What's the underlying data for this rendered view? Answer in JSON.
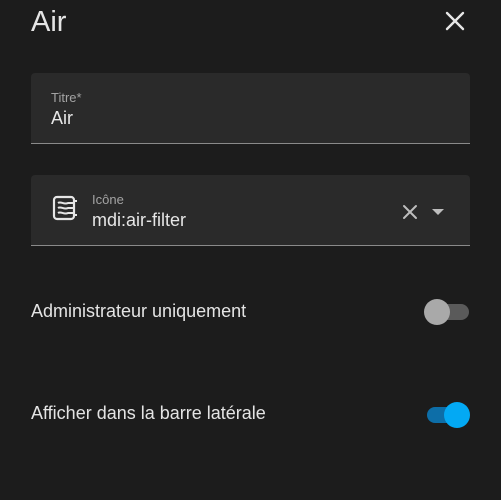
{
  "dialog": {
    "title": "Air"
  },
  "title_field": {
    "label": "Titre*",
    "value": "Air"
  },
  "icon_field": {
    "label": "Icône",
    "value": "mdi:air-filter",
    "icon": "air-filter-icon"
  },
  "admin_only": {
    "label": "Administrateur uniquement",
    "enabled": false
  },
  "show_in_sidebar": {
    "label": "Afficher dans la barre latérale",
    "enabled": true
  },
  "colors": {
    "background": "#1c1c1c",
    "field_background": "#2a2a2a",
    "accent": "#03a9f4",
    "switch_off_thumb": "#a9a9a9"
  }
}
